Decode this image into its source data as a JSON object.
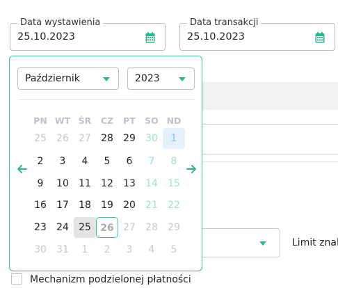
{
  "fields": {
    "issue_date": {
      "label": "Data wystawienia",
      "value": "25.10.2023"
    },
    "transaction_date": {
      "label": "Data transakcji",
      "value": "25.10.2023"
    }
  },
  "datepicker": {
    "month": "Październik",
    "year": "2023",
    "weekdays": [
      "PN",
      "WT",
      "ŚR",
      "CZ",
      "PT",
      "SO",
      "ND"
    ],
    "weeks": [
      [
        "25",
        "26",
        "27",
        "28",
        "29",
        "30",
        "1"
      ],
      [
        "2",
        "3",
        "4",
        "5",
        "6",
        "7",
        "8"
      ],
      [
        "9",
        "10",
        "11",
        "12",
        "13",
        "14",
        "15"
      ],
      [
        "16",
        "17",
        "18",
        "19",
        "20",
        "21",
        "22"
      ],
      [
        "23",
        "24",
        "25",
        "26",
        "27",
        "28",
        "29"
      ],
      [
        "30",
        "31",
        "1",
        "2",
        "3",
        "4",
        "5"
      ]
    ]
  },
  "background": {
    "limit_label": "Limit znal",
    "split_payment_label": "Mechanizm podzielonej płatności"
  },
  "colors": {
    "accent": "#3cc39c",
    "today_bg": "#e4f1fd",
    "selected_bg": "#e3e4e6"
  },
  "icons": {
    "date_field": "calendar-icon",
    "prev": "arrow-left-icon",
    "next": "arrow-right-icon"
  }
}
